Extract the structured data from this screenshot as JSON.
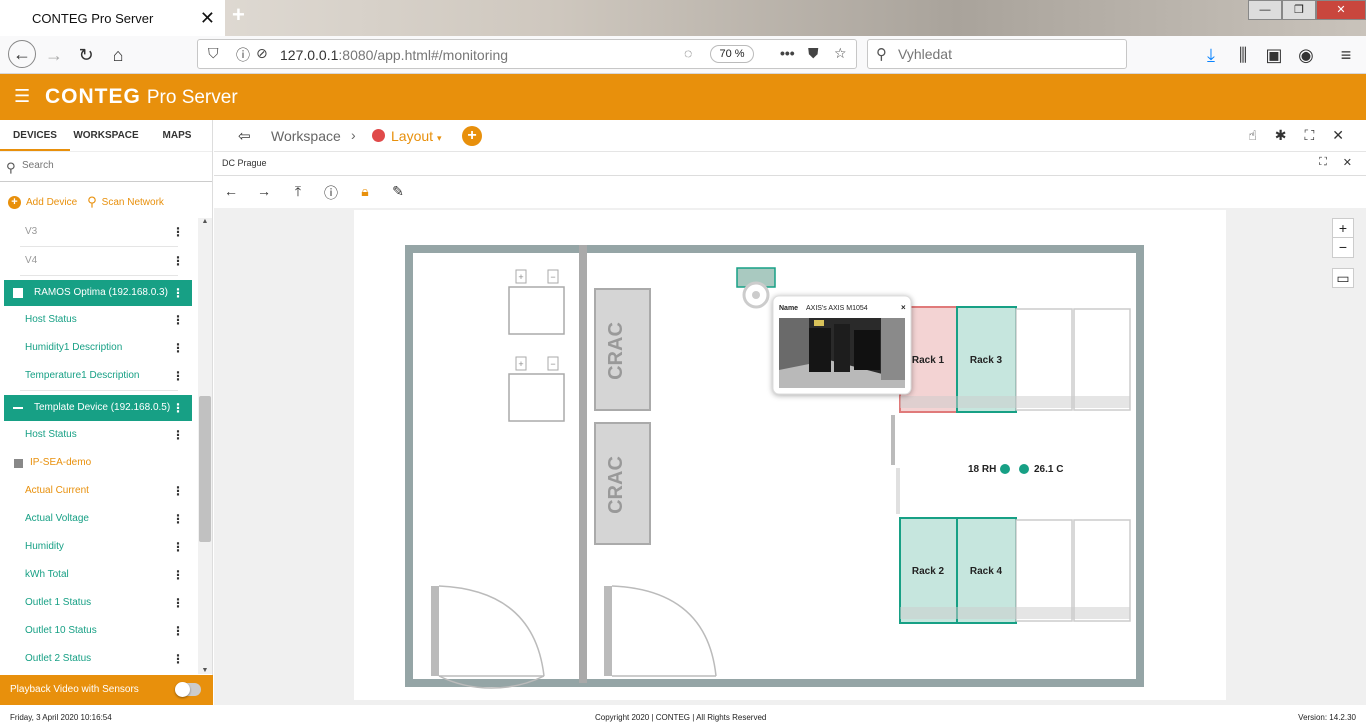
{
  "browser": {
    "tab_title": "CONTEG Pro Server",
    "url_host": "127.0.0.1",
    "url_rest": ":8080/app.html#/monitoring",
    "zoom": "70 %",
    "search_placeholder": "Vyhledat"
  },
  "app": {
    "brand": "CONTEG",
    "brand_sub": "Pro Server",
    "accent": "#e8900c",
    "teal": "#17a085"
  },
  "sidebar": {
    "tabs": [
      "DEVICES",
      "WORKSPACE",
      "MAPS"
    ],
    "search_placeholder": "Search",
    "add_device": "Add Device",
    "scan_network": "Scan Network",
    "items": {
      "v3": "V3",
      "v4": "V4",
      "ramos": "RAMOS Optima (192.168.0.3)",
      "ramos_host": "Host Status",
      "ramos_hum": "Humidity1 Description",
      "ramos_temp": "Temperature1 Description",
      "template": "Template Device (192.168.0.5)",
      "tpl_host": "Host Status",
      "ipsea": "IP-SEA-demo",
      "cur": "Actual Current",
      "volt": "Actual Voltage",
      "hum": "Humidity",
      "kwh": "kWh Total",
      "o1": "Outlet 1 Status",
      "o10": "Outlet 10 Status",
      "o2": "Outlet 2 Status"
    },
    "playback": "Playback Video with Sensors"
  },
  "breadcrumb": {
    "workspace": "Workspace",
    "layout": "Layout"
  },
  "panel": {
    "title": "DC Prague"
  },
  "floor": {
    "crac": "CRAC",
    "racks": [
      "Rack 1",
      "Rack 3",
      "Rack 2",
      "Rack 4"
    ],
    "humidity": "18 RH",
    "temperature": "26.1 C",
    "popup_label": "Name",
    "popup_name": "AXIS's AXIS M1054"
  },
  "status": {
    "datetime": "Friday, 3 April 2020 10:16:54",
    "copyright": "Copyright 2020 | CONTEG | All Rights Reserved",
    "version": "Version: 14.2.30"
  }
}
